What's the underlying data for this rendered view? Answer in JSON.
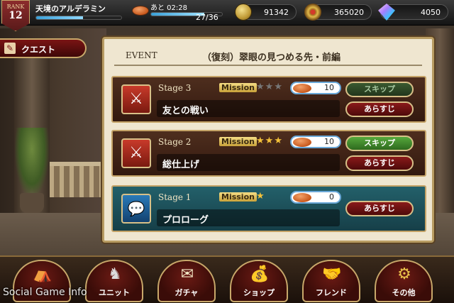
{
  "player": {
    "rank_label": "RANK",
    "rank": "12",
    "name": "天境のアルデラミン",
    "exp_progress": 0.55
  },
  "stamina": {
    "timer": "あと 02:28",
    "count": "27/36",
    "progress": 0.75
  },
  "currencies": {
    "coins": "91342",
    "medals": "365020",
    "gems": "4050"
  },
  "quest_tab": {
    "label": "クエスト"
  },
  "event": {
    "tag": "EVENT",
    "title": "（復刻）翠眼の見つめる先・前編"
  },
  "stages": [
    {
      "stage_label": "Stage 3",
      "mission_label": "Mission",
      "stars_earned": 0,
      "stars_total": 3,
      "cost": "10",
      "name": "友との戦い",
      "skip_label": "スキップ",
      "skip_enabled": false,
      "plot_label": "あらすじ"
    },
    {
      "stage_label": "Stage 2",
      "mission_label": "Mission",
      "stars_earned": 3,
      "stars_total": 3,
      "cost": "10",
      "name": "総仕上げ",
      "skip_label": "スキップ",
      "skip_enabled": true,
      "plot_label": "あらすじ"
    },
    {
      "stage_label": "Stage 1",
      "mission_label": "Mission",
      "stars_earned": 1,
      "stars_total": 1,
      "cost": "0",
      "name": "プロローグ",
      "plot_label": "あらすじ"
    }
  ],
  "nav": [
    {
      "label": "",
      "icon": "tent-icon"
    },
    {
      "label": "ユニット",
      "icon": "unit-icon"
    },
    {
      "label": "ガチャ",
      "icon": "gacha-icon"
    },
    {
      "label": "ショップ",
      "icon": "shop-icon"
    },
    {
      "label": "フレンド",
      "icon": "friend-icon"
    },
    {
      "label": "その他",
      "icon": "gear-icon"
    }
  ],
  "watermark": "Social Game Info"
}
